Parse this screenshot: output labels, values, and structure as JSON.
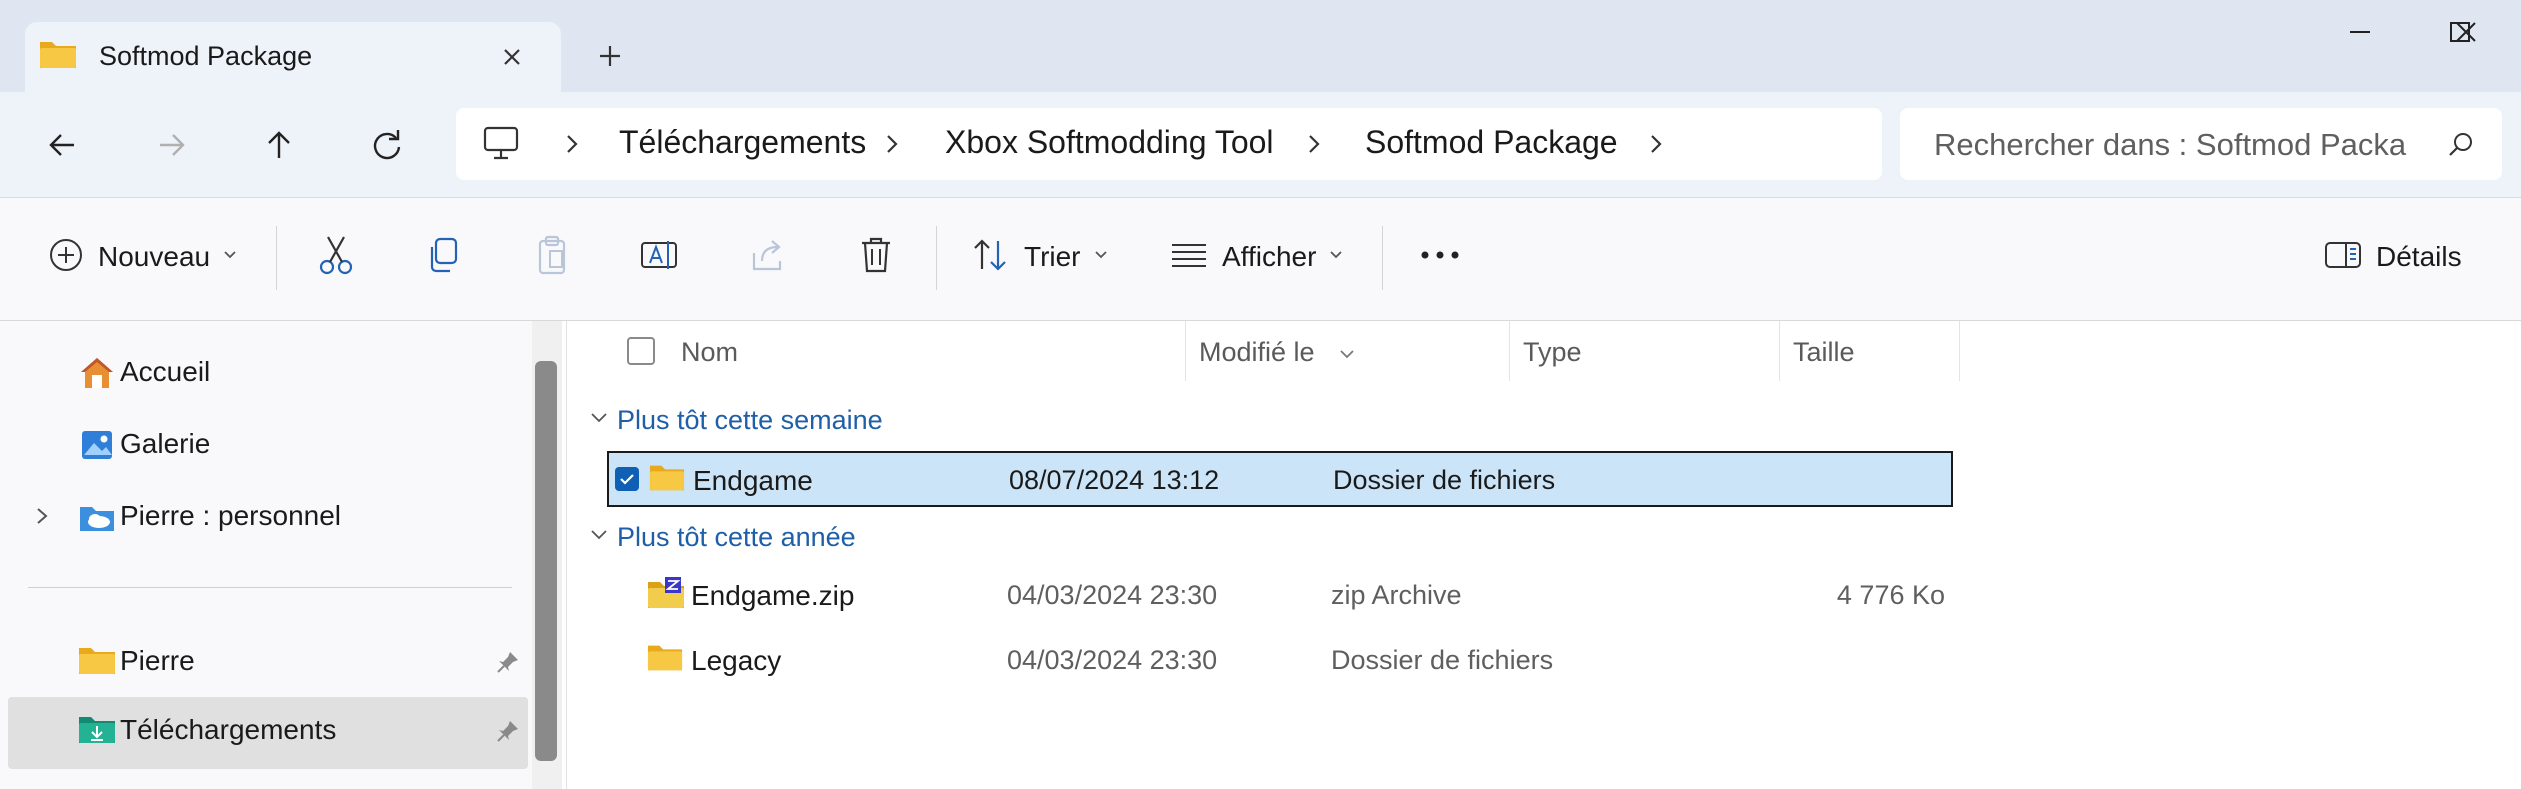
{
  "tab": {
    "title": "Softmod Package"
  },
  "address": {
    "crumbs": [
      "Téléchargements",
      "Xbox Softmodding Tool",
      "Softmod Package"
    ]
  },
  "search": {
    "placeholder": "Rechercher dans : Softmod Packa"
  },
  "toolbar": {
    "new_label": "Nouveau",
    "sort_label": "Trier",
    "view_label": "Afficher",
    "details_label": "Détails"
  },
  "sidebar": {
    "items": [
      {
        "label": "Accueil",
        "icon": "home-icon"
      },
      {
        "label": "Galerie",
        "icon": "gallery-icon"
      },
      {
        "label": "Pierre : personnel",
        "icon": "onedrive-icon"
      },
      {
        "label": "Pierre",
        "icon": "folder-icon"
      },
      {
        "label": "Téléchargements",
        "icon": "downloads-folder-icon"
      }
    ]
  },
  "columns": {
    "name": "Nom",
    "modified": "Modifié le",
    "type": "Type",
    "size": "Taille"
  },
  "groups": [
    {
      "label": "Plus tôt cette semaine",
      "rows": [
        {
          "name": "Endgame",
          "modified": "08/07/2024 13:12",
          "type": "Dossier de fichiers",
          "size": "",
          "icon": "folder-icon",
          "selected": true
        }
      ]
    },
    {
      "label": "Plus tôt cette année",
      "rows": [
        {
          "name": "Endgame.zip",
          "modified": "04/03/2024 23:30",
          "type": "zip Archive",
          "size": "4 776 Ko",
          "icon": "zip-archive-icon",
          "selected": false
        },
        {
          "name": "Legacy",
          "modified": "04/03/2024 23:30",
          "type": "Dossier de fichiers",
          "size": "",
          "icon": "folder-icon",
          "selected": false
        }
      ]
    }
  ],
  "colors": {
    "accent": "#0f5fb5",
    "selection": "#cce4f7",
    "group_label": "#1f5fa8",
    "folder": "#f5c241"
  }
}
